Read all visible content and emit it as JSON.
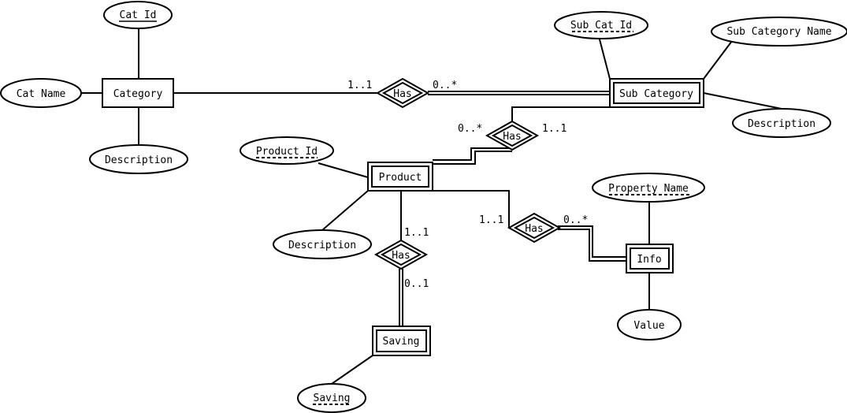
{
  "entities": {
    "category": "Category",
    "sub_category": "Sub Category",
    "product": "Product",
    "info": "Info",
    "saving": "Saving"
  },
  "attributes": {
    "cat_id": "Cat Id",
    "cat_name": "Cat Name",
    "category_description": "Description",
    "sub_cat_id": "Sub Cat Id",
    "sub_category_name": "Sub Category Name",
    "sub_category_description": "Description",
    "product_id": "Product Id",
    "product_description": "Description",
    "property_name": "Property Name",
    "value": "Value",
    "saving": "Saving"
  },
  "relationships": {
    "category_sub": "Has",
    "sub_product": "Has",
    "product_saving": "Has",
    "product_info": "Has"
  },
  "cardinalities": {
    "category_side": "1..1",
    "sub_category_side": "0..*",
    "product_side_of_sub": "0..*",
    "sub_side_of_product": "1..1",
    "product_side_of_saving": "1..1",
    "saving_side": "0..1",
    "product_side_of_info": "1..1",
    "info_side": "0..*"
  }
}
